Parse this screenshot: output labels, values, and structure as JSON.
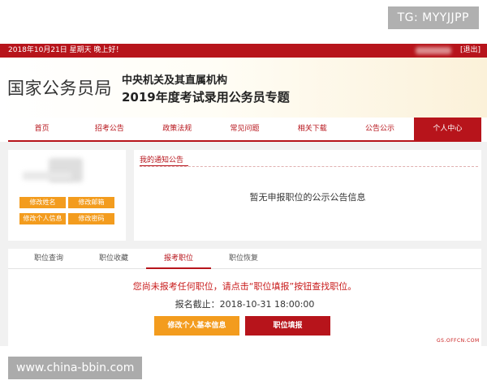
{
  "watermark_top": "TG: MYYJJPP",
  "watermark_bottom": "www.china-bbin.com",
  "topbar": {
    "date_greeting": "2018年10月21日  星期天  晚上好！",
    "logout": "[退出]"
  },
  "header": {
    "bureau": "国家公务员局",
    "line1": "中央机关及其直属机构",
    "line2": "2019年度考试录用公务员专题"
  },
  "nav": {
    "items": [
      "首页",
      "招考公告",
      "政策法规",
      "常见问题",
      "相关下载",
      "公告公示",
      "个人中心"
    ],
    "active_index": 6
  },
  "profile": {
    "buttons": [
      "修改姓名",
      "修改邮箱",
      "修改个人信息",
      "修改密码"
    ]
  },
  "notice": {
    "title": "我的通知公告",
    "empty_text": "暂无申报职位的公示公告信息"
  },
  "jobs": {
    "tabs": [
      "职位查询",
      "职位收藏",
      "报考职位",
      "职位恢复"
    ],
    "active_tab": 2,
    "message": "您尚未报考任何职位，请点击“职位填报”按钮查找职位。",
    "deadline": "报名截止：2018-10-31 18:00:00",
    "edit_button": "修改个人基本信息",
    "fill_button": "职位填报"
  },
  "site_mark": "GS.OFFCN.COM",
  "colors": {
    "brand_red": "#b7141b",
    "accent_orange": "#f39c1e",
    "panel_bg": "#f1f1f1"
  }
}
